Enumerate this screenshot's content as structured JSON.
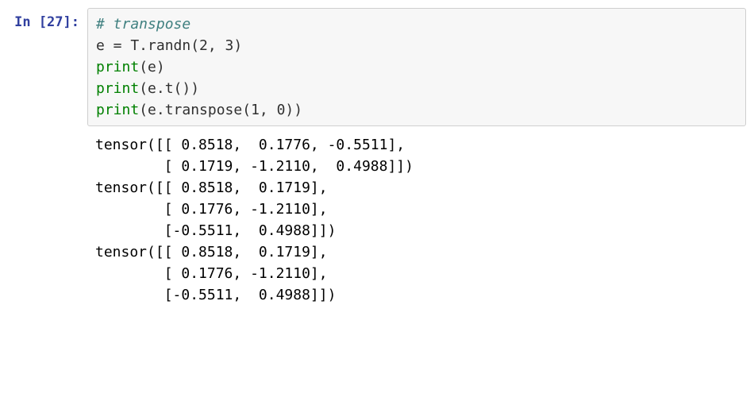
{
  "cell": {
    "prompt_label": "In ",
    "prompt_number": "[27]:",
    "code": {
      "line1_comment": "# transpose",
      "line2": "e = T.randn(2, 3)",
      "line3_print": "print",
      "line3_rest": "(e)",
      "line4_print": "print",
      "line4_rest": "(e.t())",
      "line5_print": "print",
      "line5_rest": "(e.transpose(1, 0))"
    },
    "output": "tensor([[ 0.8518,  0.1776, -0.5511],\n        [ 0.1719, -1.2110,  0.4988]])\ntensor([[ 0.8518,  0.1719],\n        [ 0.1776, -1.2110],\n        [-0.5511,  0.4988]])\ntensor([[ 0.8518,  0.1719],\n        [ 0.1776, -1.2110],\n        [-0.5511,  0.4988]])"
  }
}
